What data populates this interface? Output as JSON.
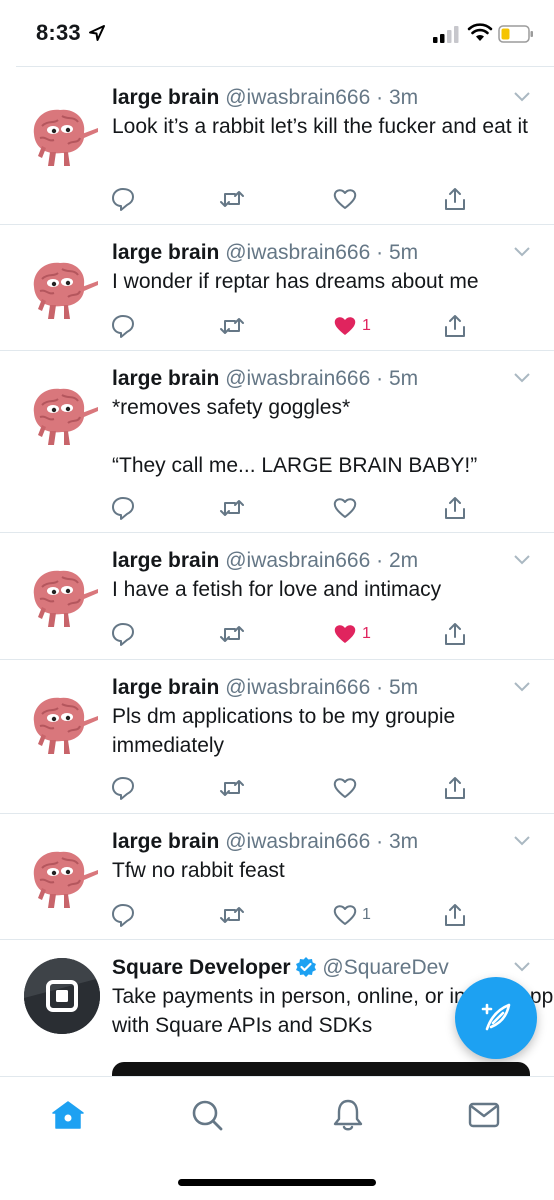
{
  "status_bar": {
    "time": "8:33",
    "icons": [
      "location-arrow-icon",
      "signal-icon",
      "wifi-icon",
      "battery-icon"
    ]
  },
  "colors": {
    "accent": "#1da1f2",
    "like_active": "#e0245e",
    "secondary_text": "#657786",
    "divider": "#e1e8ed"
  },
  "tweets": [
    {
      "name": "large brain",
      "handle": "@iwasbrain666",
      "dot": "·",
      "time": "3m",
      "text": "Look it’s a rabbit let’s kill the fucker and eat it",
      "liked": false,
      "like_count": ""
    },
    {
      "name": "large brain",
      "handle": "@iwasbrain666",
      "dot": "·",
      "time": "5m",
      "text": "I wonder if reptar has dreams about me",
      "liked": true,
      "like_count": "1"
    },
    {
      "name": "large brain",
      "handle": "@iwasbrain666",
      "dot": "·",
      "time": "5m",
      "text": "*removes safety goggles*\n\n“They call me... LARGE BRAIN BABY!”",
      "liked": false,
      "like_count": ""
    },
    {
      "name": "large brain",
      "handle": "@iwasbrain666",
      "dot": "·",
      "time": "2m",
      "text": "I have a fetish for love and intimacy",
      "liked": true,
      "like_count": "1"
    },
    {
      "name": "large brain",
      "handle": "@iwasbrain666",
      "dot": "·",
      "time": "5m",
      "text": "Pls dm applications to be my groupie immediately",
      "liked": false,
      "like_count": ""
    },
    {
      "name": "large brain",
      "handle": "@iwasbrain666",
      "dot": "·",
      "time": "3m",
      "text": "Tfw no rabbit feast",
      "liked": false,
      "like_count": "1"
    },
    {
      "name": "Square Developer",
      "handle": "@SquareDev",
      "verified": true,
      "text": "Take payments in person, online, or in your app with Square APIs and SDKs"
    }
  ],
  "fab": {
    "icon": "compose-tweet-icon"
  },
  "tabbar": {
    "tabs": [
      {
        "icon": "home-icon",
        "active": true
      },
      {
        "icon": "search-icon",
        "active": false
      },
      {
        "icon": "bell-icon",
        "active": false
      },
      {
        "icon": "mail-icon",
        "active": false
      }
    ]
  }
}
